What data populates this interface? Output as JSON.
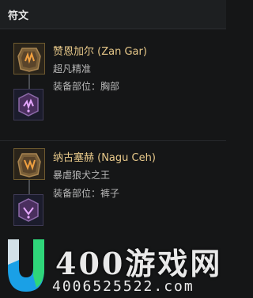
{
  "header": {
    "title": "符文"
  },
  "runes": [
    {
      "name": "赞恩加尔 (Zan Gar)",
      "type": "超凡精准",
      "slot": "装备部位：胸部",
      "rune_icon": "rune-zan-gar-icon",
      "gem_icon": "purple-gem-icon"
    },
    {
      "name": "纳古塞赫 (Nagu Ceh)",
      "type": "暴虐狼犬之王",
      "slot": "装备部位：裤子",
      "rune_icon": "rune-nagu-ceh-icon",
      "gem_icon": "purple-gem-icon"
    }
  ],
  "watermark": {
    "brand": "400游戏网",
    "number": "4006525522.com"
  },
  "colors": {
    "background": "#151617",
    "header": "#1d1f21",
    "name": "#e8c98a",
    "subtext": "#b8b8b8",
    "logo_blue": "#1aa0e6",
    "logo_green": "#2fd67a"
  }
}
